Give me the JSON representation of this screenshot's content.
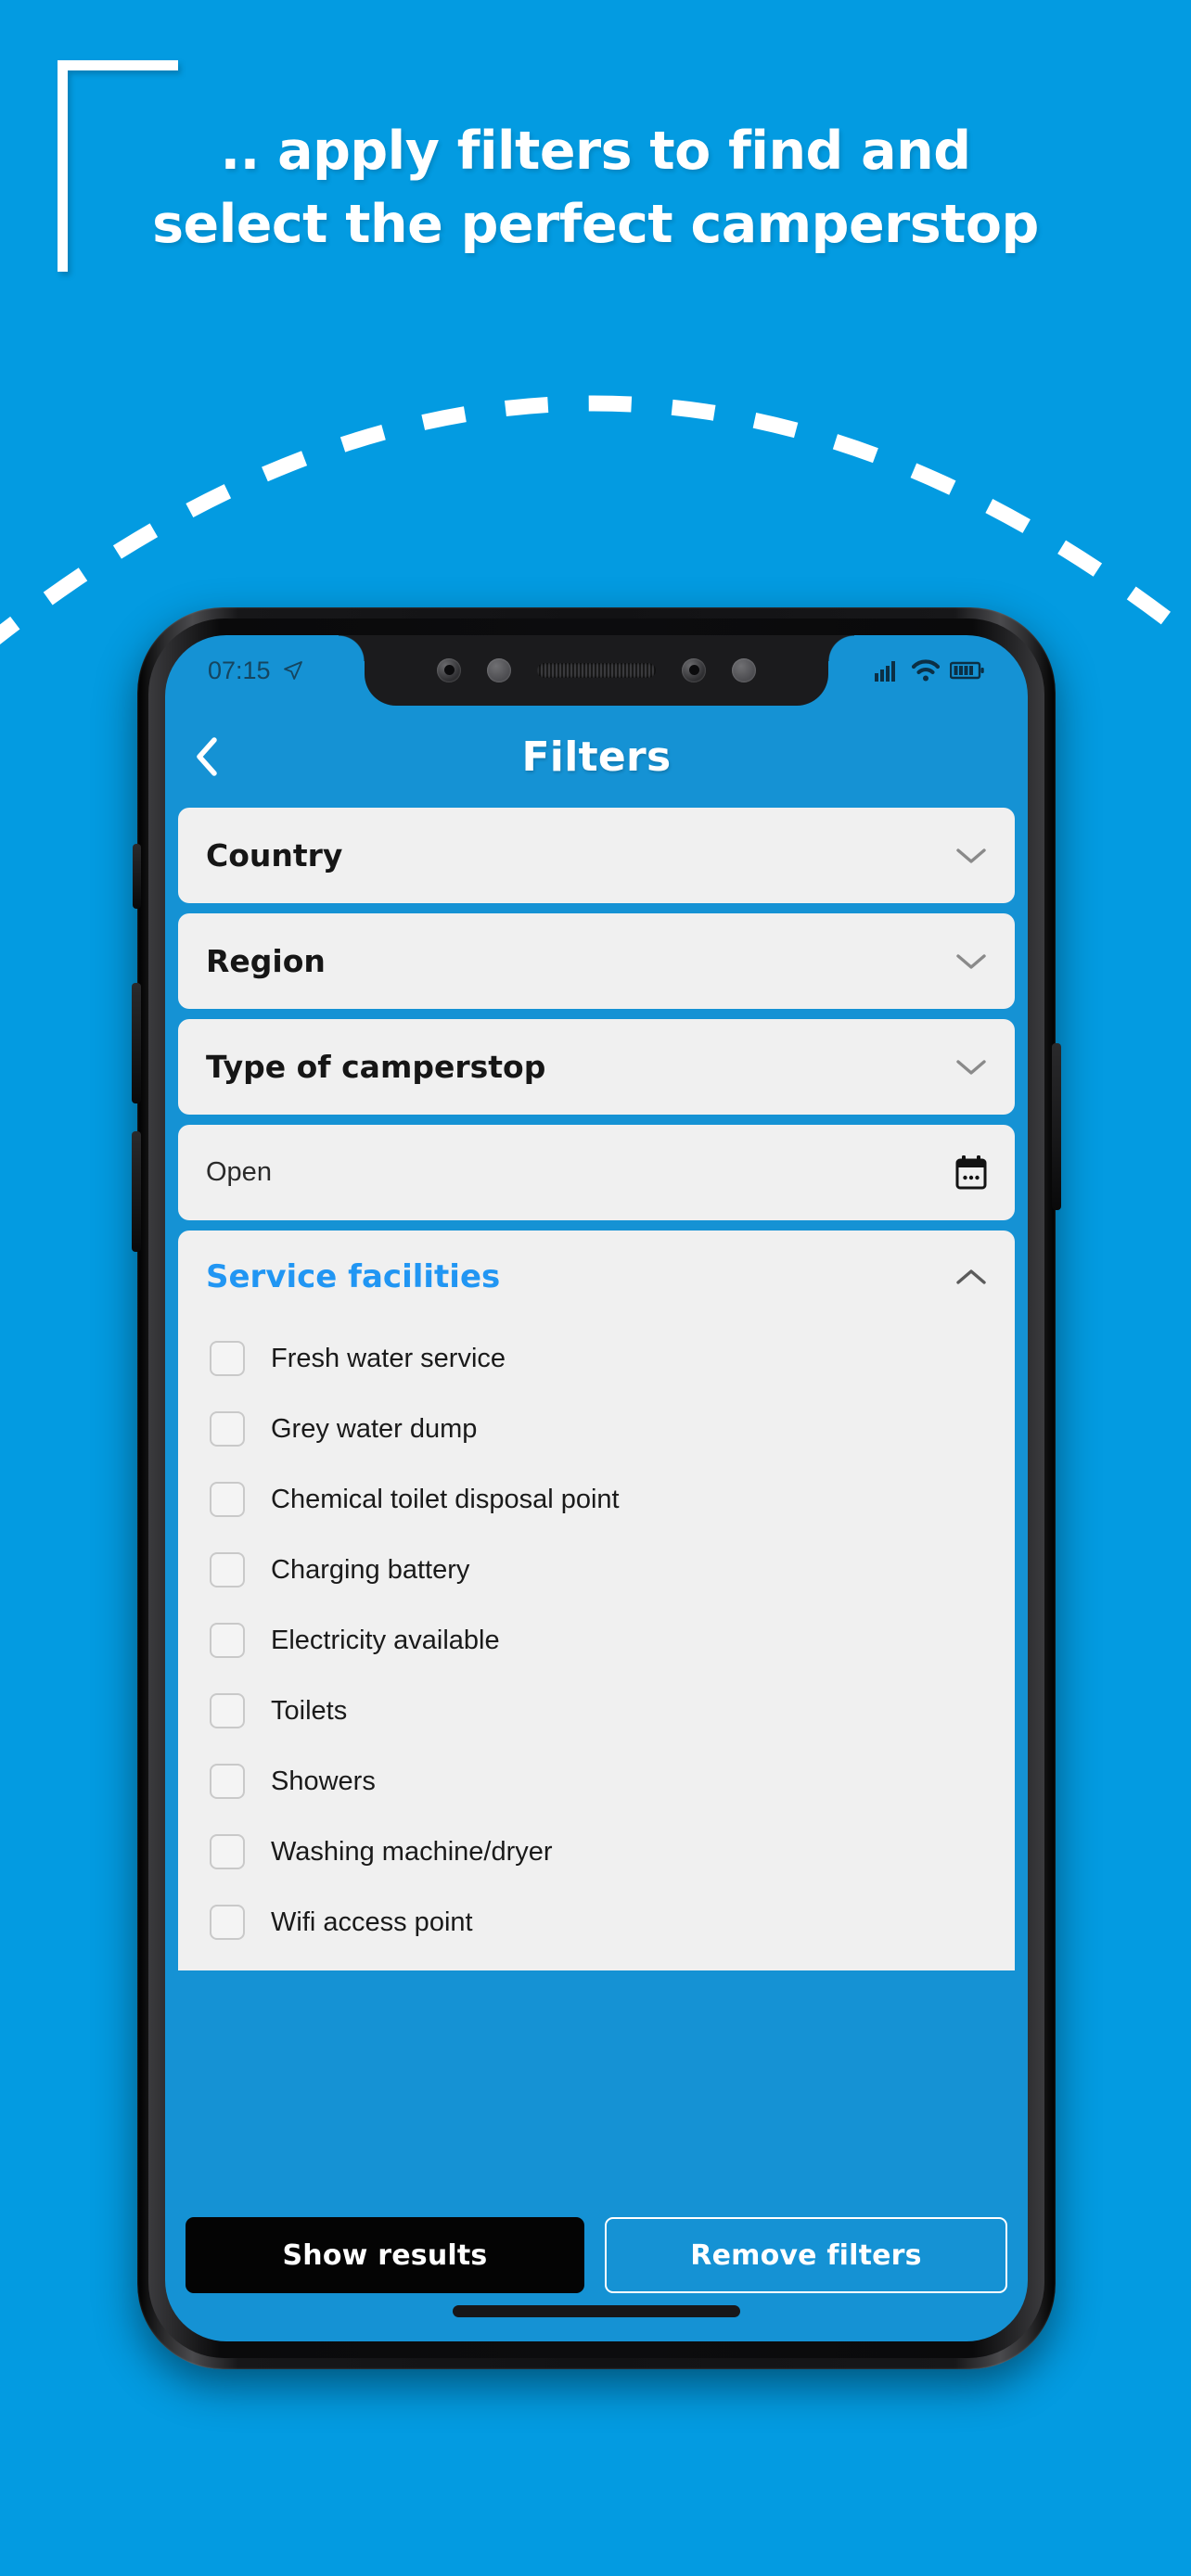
{
  "theme": {
    "background": "#039BE1",
    "screen_blue": "#1592D4",
    "accent_blue": "#2196F3",
    "field_bg": "#f0f0f0",
    "primary_button_bg": "#040404"
  },
  "promo": {
    "line1": ".. apply filters to find and",
    "line2": "select the perfect camperstop",
    "bracket_icon": "corner-bracket-decoration",
    "arc_icon": "dashed-arc-decoration"
  },
  "phone": {
    "notch_icons": [
      "camera-lens-icon",
      "sensor-icon",
      "speaker-grille-icon",
      "camera-lens-icon",
      "sensor-icon"
    ],
    "side_buttons": [
      "mute-switch",
      "volume-up-button",
      "volume-down-button",
      "power-button"
    ],
    "home_indicator": "home-indicator"
  },
  "status_bar": {
    "time": "07:15",
    "location_icon": "location-arrow-icon",
    "signal_icon": "cellular-signal-icon",
    "wifi_icon": "wifi-icon",
    "battery_icon": "battery-full-icon"
  },
  "appbar": {
    "back_icon": "chevron-left-icon",
    "title": "Filters"
  },
  "filters": {
    "fields": [
      {
        "label": "Country",
        "icon": "chevron-down-icon",
        "style": "bold"
      },
      {
        "label": "Region",
        "icon": "chevron-down-icon",
        "style": "bold"
      },
      {
        "label": "Type of camperstop",
        "icon": "chevron-down-icon",
        "style": "bold"
      },
      {
        "label": "Open",
        "icon": "calendar-icon",
        "style": "placeholder"
      }
    ],
    "section": {
      "title": "Service facilities",
      "toggle_icon": "chevron-up-icon",
      "expanded": true,
      "options": [
        {
          "label": "Fresh water service",
          "checked": false
        },
        {
          "label": "Grey water dump",
          "checked": false
        },
        {
          "label": "Chemical toilet disposal point",
          "checked": false
        },
        {
          "label": "Charging battery",
          "checked": false
        },
        {
          "label": "Electricity available",
          "checked": false
        },
        {
          "label": "Toilets",
          "checked": false
        },
        {
          "label": "Showers",
          "checked": false
        },
        {
          "label": "Washing machine/dryer",
          "checked": false
        },
        {
          "label": "Wifi access point",
          "checked": false
        }
      ]
    }
  },
  "footer": {
    "primary_label": "Show results",
    "secondary_label": "Remove filters"
  }
}
